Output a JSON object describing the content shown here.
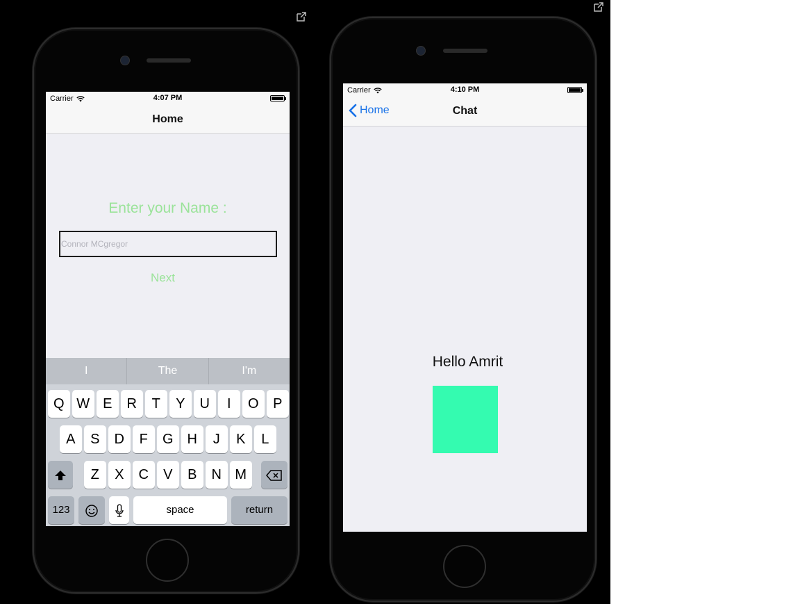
{
  "left_phone": {
    "status": {
      "carrier": "Carrier",
      "time": "4:07 PM"
    },
    "nav": {
      "title": "Home"
    },
    "prompt": "Enter your Name :",
    "name_input": {
      "placeholder": "Connor MCgregor",
      "value": ""
    },
    "next_label": "Next",
    "keyboard": {
      "suggestions": [
        "I",
        "The",
        "I'm"
      ],
      "row1": [
        "Q",
        "W",
        "E",
        "R",
        "T",
        "Y",
        "U",
        "I",
        "O",
        "P"
      ],
      "row2": [
        "A",
        "S",
        "D",
        "F",
        "G",
        "H",
        "J",
        "K",
        "L"
      ],
      "row3": [
        "Z",
        "X",
        "C",
        "V",
        "B",
        "N",
        "M"
      ],
      "numbers_label": "123",
      "space_label": "space",
      "return_label": "return",
      "shift_icon": "shift-arrow-icon",
      "delete_icon": "backspace-icon",
      "emoji_icon": "emoji-icon",
      "mic_icon": "microphone-icon"
    }
  },
  "right_phone": {
    "status": {
      "carrier": "Carrier",
      "time": "4:10 PM"
    },
    "nav": {
      "title": "Chat",
      "back_label": "Home"
    },
    "hello_text": "Hello Amrit",
    "box_color": "#34fbb0"
  },
  "colors": {
    "accent_green": "#9be39a",
    "ios_blue": "#1a73e8"
  },
  "icons": {
    "external": "external-link-icon",
    "wifi": "wifi-icon",
    "battery": "battery-icon"
  }
}
